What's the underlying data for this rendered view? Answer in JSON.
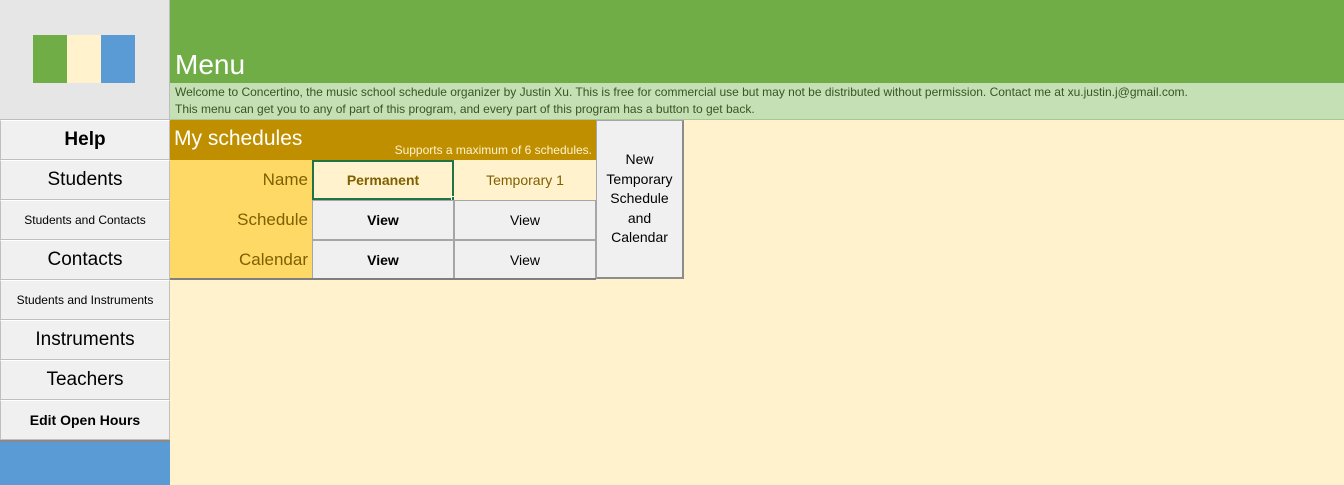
{
  "logo": {
    "stripes": [
      "#70ad47",
      "#fff2cc",
      "#5b9bd5"
    ]
  },
  "header": {
    "title": "Menu",
    "info_line1": "Welcome to Concertino, the music school schedule organizer by Justin Xu. This is free for commercial use but may not be distributed without permission. Contact me at xu.justin.j@gmail.com.",
    "info_line2": "This menu can get you to any of part of this program, and every part of this program has a button to get back."
  },
  "sidebar": {
    "items": [
      {
        "label": "Help"
      },
      {
        "label": "Students"
      },
      {
        "label": "Students and Contacts"
      },
      {
        "label": "Contacts"
      },
      {
        "label": "Students and Instruments"
      },
      {
        "label": "Instruments"
      },
      {
        "label": "Teachers"
      },
      {
        "label": "Edit Open Hours"
      }
    ]
  },
  "schedules": {
    "title": "My schedules",
    "note": "Supports a maximum of 6 schedules.",
    "row_labels": {
      "name": "Name",
      "schedule": "Schedule",
      "calendar": "Calendar"
    },
    "columns": [
      {
        "name": "Permanent",
        "schedule": "View",
        "calendar": "View"
      },
      {
        "name": "Temporary 1",
        "schedule": "View",
        "calendar": "View"
      }
    ],
    "new_button": "New Temporary Schedule and Calendar"
  },
  "colors": {
    "header_green": "#70ad47",
    "info_green": "#c5e0b4",
    "cream_bg": "#fff2cc",
    "gold": "#bf8f00",
    "label_yellow": "#ffd966",
    "sidebar_blue": "#5b9bd5"
  }
}
